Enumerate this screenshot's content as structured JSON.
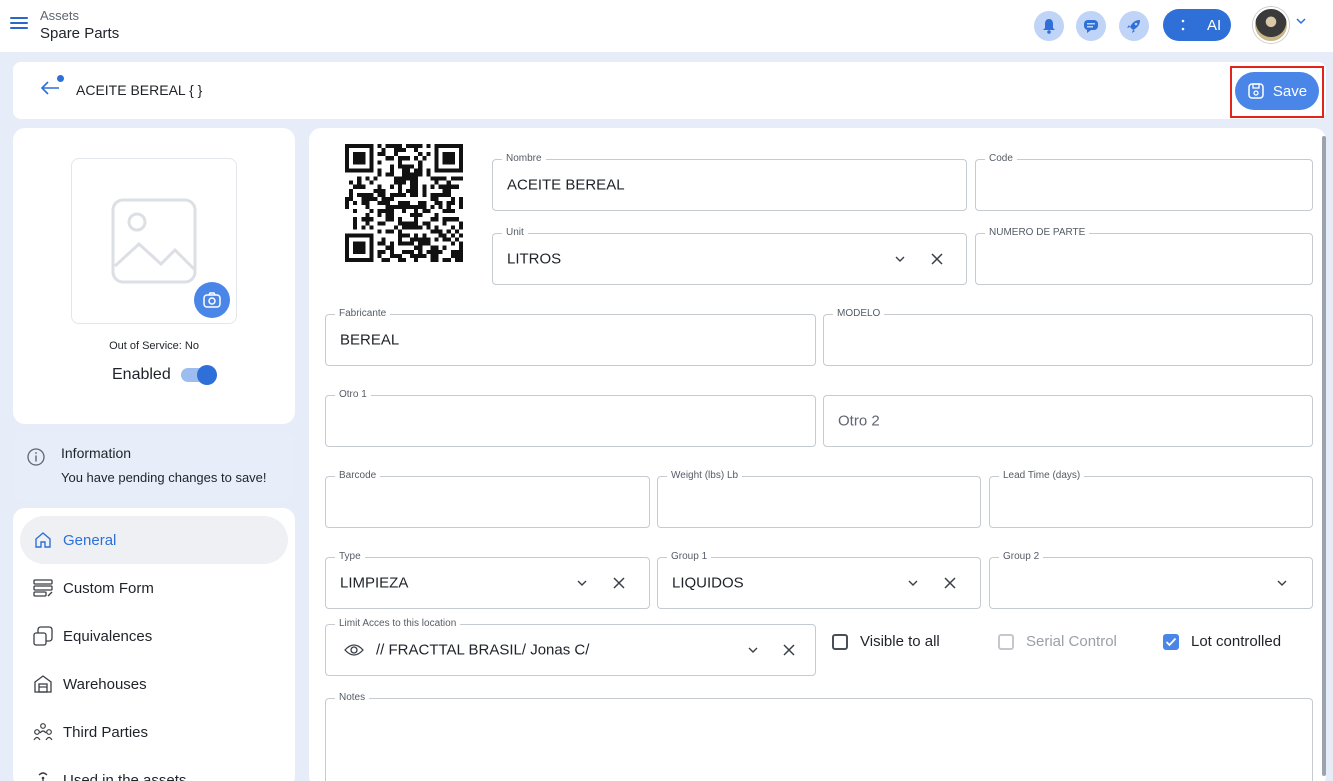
{
  "topbar": {
    "crumb_section": "Assets",
    "crumb_page": "Spare Parts",
    "ai_label": "AI",
    "accent": "#2e6fd8"
  },
  "header": {
    "title": "ACEITE BEREAL { }",
    "save_label": "Save"
  },
  "left": {
    "out_of_service": "Out of Service: No",
    "enabled_label": "Enabled",
    "enabled": true
  },
  "info": {
    "title": "Information",
    "message": "You have pending changes to save!"
  },
  "nav": {
    "items": [
      {
        "label": "General",
        "icon": "home-icon"
      },
      {
        "label": "Custom Form",
        "icon": "form-icon"
      },
      {
        "label": "Equivalences",
        "icon": "equivalences-icon"
      },
      {
        "label": "Warehouses",
        "icon": "warehouse-icon"
      },
      {
        "label": "Third Parties",
        "icon": "people-icon"
      },
      {
        "label": "Used in the assets",
        "icon": "antenna-icon"
      }
    ]
  },
  "form": {
    "nombre": {
      "label": "Nombre",
      "value": "ACEITE BEREAL"
    },
    "code": {
      "label": "Code",
      "value": ""
    },
    "unit": {
      "label": "Unit",
      "value": "LITROS"
    },
    "numero_parte": {
      "label": "NUMERO DE PARTE",
      "value": ""
    },
    "fabricante": {
      "label": "Fabricante",
      "value": "BEREAL"
    },
    "modelo": {
      "label": "MODELO",
      "value": ""
    },
    "otro1": {
      "label": "Otro 1",
      "value": ""
    },
    "otro2": {
      "placeholder": "Otro 2"
    },
    "barcode": {
      "label": "Barcode",
      "value": ""
    },
    "weight": {
      "label": "Weight (lbs) Lb",
      "value": ""
    },
    "lead_time": {
      "label": "Lead Time (days)",
      "value": ""
    },
    "type": {
      "label": "Type",
      "value": "LIMPIEZA"
    },
    "group1": {
      "label": "Group 1",
      "value": "LIQUIDOS"
    },
    "group2": {
      "label": "Group 2",
      "value": ""
    },
    "location": {
      "label": "Limit Acces to this location",
      "value": "// FRACTTAL BRASIL/  Jonas C/"
    },
    "visible_to_all": {
      "label": "Visible to all",
      "checked": false
    },
    "serial_control": {
      "label": "Serial Control",
      "checked": false,
      "disabled": true
    },
    "lot_controlled": {
      "label": "Lot controlled",
      "checked": true
    },
    "notes": {
      "label": "Notes",
      "value": ""
    }
  }
}
